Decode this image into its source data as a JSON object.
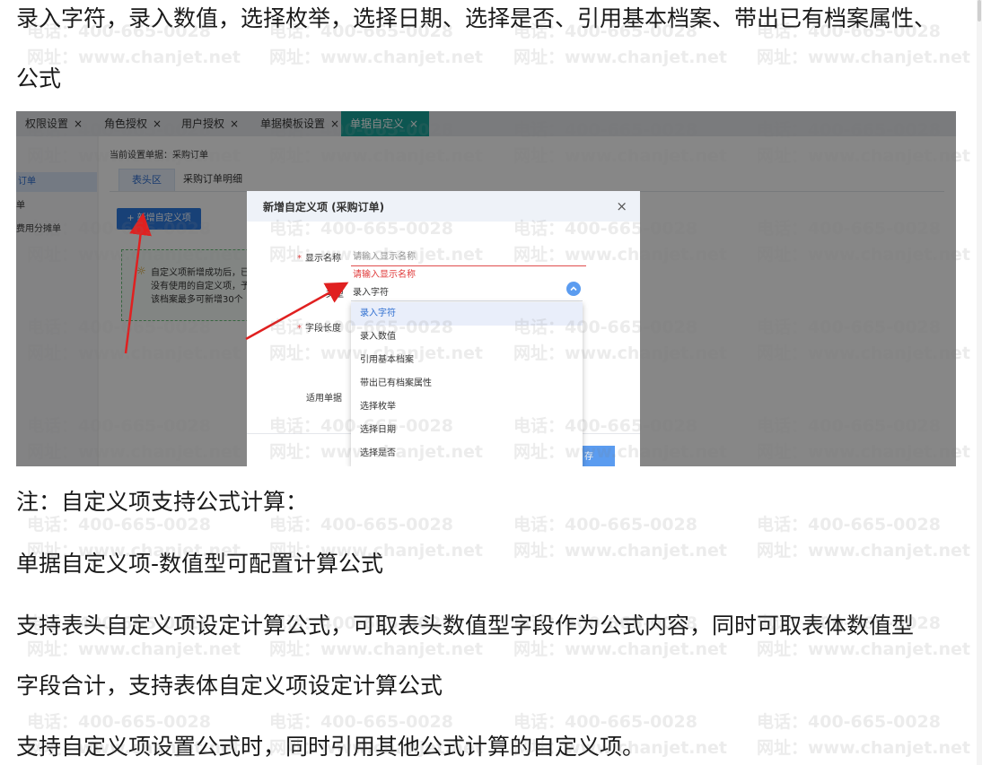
{
  "document": {
    "line1": "录入字符，录入数值，选择枚举，选择日期、选择是否、引用基本档案、带出已有档案属性、",
    "line2": "公式",
    "note": "注：自定义项支持公式计算：",
    "para1": "单据自定义项-数值型可配置计算公式",
    "para2a": "支持表头自定义项设定计算公式，可取表头数值型字段作为公式内容，同时可取表体数值型",
    "para2b": "字段合计，支持表体自定义项设定计算公式",
    "para3": "支持自定义项设置公式时，同时引用其他公式计算的自定义项。"
  },
  "screenshot": {
    "tabs": [
      {
        "label": "权限设置",
        "close": "×"
      },
      {
        "label": "角色授权",
        "close": "×"
      },
      {
        "label": "用户授权",
        "close": "×"
      },
      {
        "label": "单据模板设置",
        "close": "×"
      },
      {
        "label": "单据自定义",
        "close": "×",
        "active": true
      }
    ],
    "current_doc": "当前设置单据：采购订单",
    "subtabs": [
      "表头区",
      "采购订单明细"
    ],
    "sidebar_items": [
      "订单",
      "单",
      "费用分摊单"
    ],
    "add_button": "+ 新增自定义项",
    "hint_lines": [
      "自定义项新增成功后，已",
      "没有使用的自定义项，予",
      "该档案最多可新增30个"
    ],
    "modal": {
      "title": "新增自定义项 (采购订单)",
      "close": "×",
      "label_name": "显示名称",
      "required_mark": "*",
      "name_placeholder": "请输入显示名称",
      "name_error": "请输入显示名称",
      "label_type": "类型",
      "type_value": "录入字符",
      "label_length": "字段长度",
      "label_apply": "适用单据",
      "save": "存",
      "options": [
        "录入字符",
        "录入数值",
        "引用基本档案",
        "带出已有档案属性",
        "选择枚举",
        "选择日期",
        "选择是否"
      ]
    },
    "colors": {
      "accent": "#1aa39a",
      "primary": "#2f7be0",
      "error": "#e03b3b",
      "arrow": "#e02020"
    }
  },
  "watermark": {
    "phone": "电话：400-665-0028",
    "site": "网址：www.chanjet.net"
  }
}
